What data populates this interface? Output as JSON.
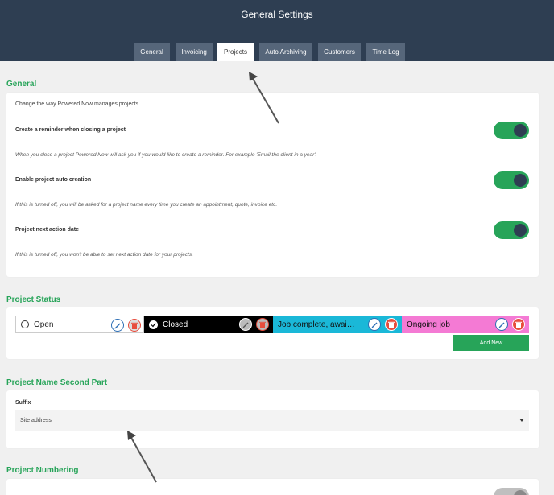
{
  "header": {
    "title": "General Settings"
  },
  "tabs": [
    {
      "label": "General",
      "active": false
    },
    {
      "label": "Invoicing",
      "active": false
    },
    {
      "label": "Projects",
      "active": true
    },
    {
      "label": "Auto Archiving",
      "active": false
    },
    {
      "label": "Customers",
      "active": false
    },
    {
      "label": "Time Log",
      "active": false
    }
  ],
  "general": {
    "title": "General",
    "intro": "Change the way Powered Now manages projects.",
    "settings": [
      {
        "label": "Create a reminder when closing a project",
        "help": "When you close a project Powered Now will ask you if you would like to create a reminder. For example 'Email the client in a year'.",
        "on": true
      },
      {
        "label": "Enable project auto creation",
        "help": "If this is turned off, you will be asked for a project name every time you create an appointment, quote, invoice etc.",
        "on": true
      },
      {
        "label": "Project next action date",
        "help": "If this is turned off, you won't be able to set next action date for your projects.",
        "on": true
      }
    ]
  },
  "project_status": {
    "title": "Project Status",
    "statuses": [
      {
        "label": "Open",
        "bg": "#ffffff",
        "fg": "#222222",
        "icon": "circle-icon"
      },
      {
        "label": "Closed",
        "bg": "#000000",
        "fg": "#ffffff",
        "icon": "check-circle-icon"
      },
      {
        "label": "Job complete, awaiting...",
        "bg": "#1ab8d8",
        "fg": "#111111",
        "icon": ""
      },
      {
        "label": "Ongoing job",
        "bg": "#f47ad4",
        "fg": "#111111",
        "icon": ""
      }
    ],
    "add_label": "Add New"
  },
  "name_second_part": {
    "title": "Project Name Second Part",
    "suffix_label": "Suffix",
    "suffix_value": "Site address"
  },
  "numbering": {
    "title": "Project Numbering"
  },
  "colors": {
    "header": "#2e3e52",
    "accent": "#27a459",
    "tab": "#56667a"
  }
}
